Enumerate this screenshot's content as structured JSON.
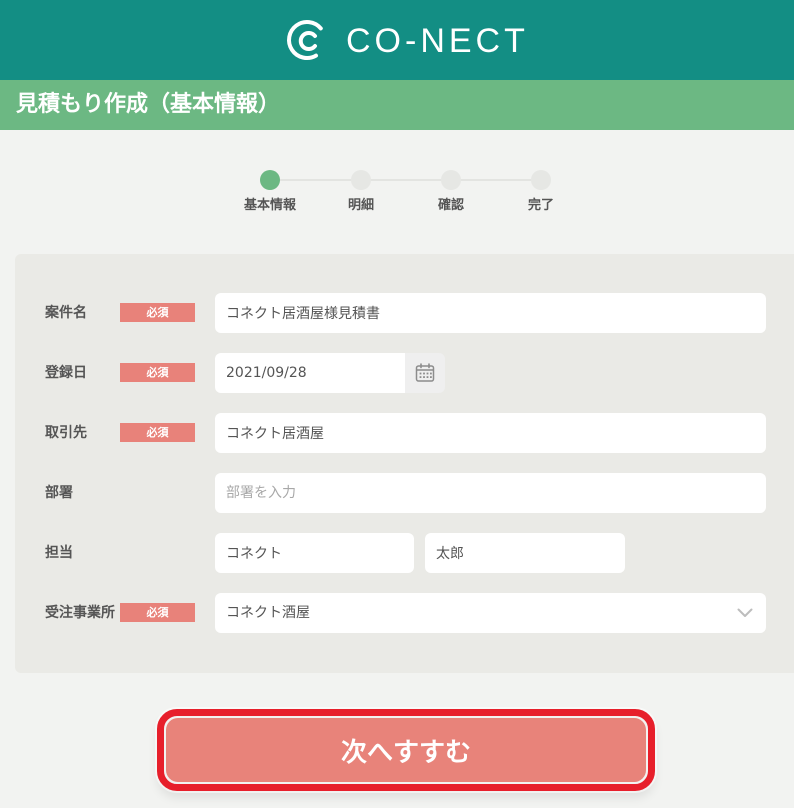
{
  "header": {
    "logo_text": "CO-NECT",
    "logo_icon": "conect-logo-icon"
  },
  "page_title": "見積もり作成（基本情報）",
  "stepper": {
    "steps": [
      {
        "label": "基本情報",
        "active": true
      },
      {
        "label": "明細",
        "active": false
      },
      {
        "label": "確認",
        "active": false
      },
      {
        "label": "完了",
        "active": false
      }
    ]
  },
  "form": {
    "required_badge": "必須",
    "project_name": {
      "label": "案件名",
      "required": true,
      "value": "コネクト居酒屋様見積書"
    },
    "registration_date": {
      "label": "登録日",
      "required": true,
      "value": "2021/09/28",
      "button_icon": "calendar-icon"
    },
    "client": {
      "label": "取引先",
      "required": true,
      "value": "コネクト居酒屋"
    },
    "department": {
      "label": "部署",
      "required": false,
      "placeholder": "部署を入力"
    },
    "assignee": {
      "label": "担当",
      "required": false,
      "last_name": "コネクト",
      "first_name": "太郎"
    },
    "office": {
      "label": "受注事業所",
      "required": true,
      "value": "コネクト酒屋",
      "dropdown_icon": "chevron-down-icon"
    }
  },
  "next_button": {
    "label": "次へすすむ"
  },
  "colors": {
    "header": "#138E84",
    "title_bar": "#6CB883",
    "step_active": "#6CB883",
    "step_inactive": "#E6E7E4",
    "required_badge": "#E8827A",
    "next_button": "#E8837A",
    "button_highlight_border": "#E71F2B",
    "page_background": "#F2F3F1",
    "panel_background": "#EAEAE6"
  }
}
